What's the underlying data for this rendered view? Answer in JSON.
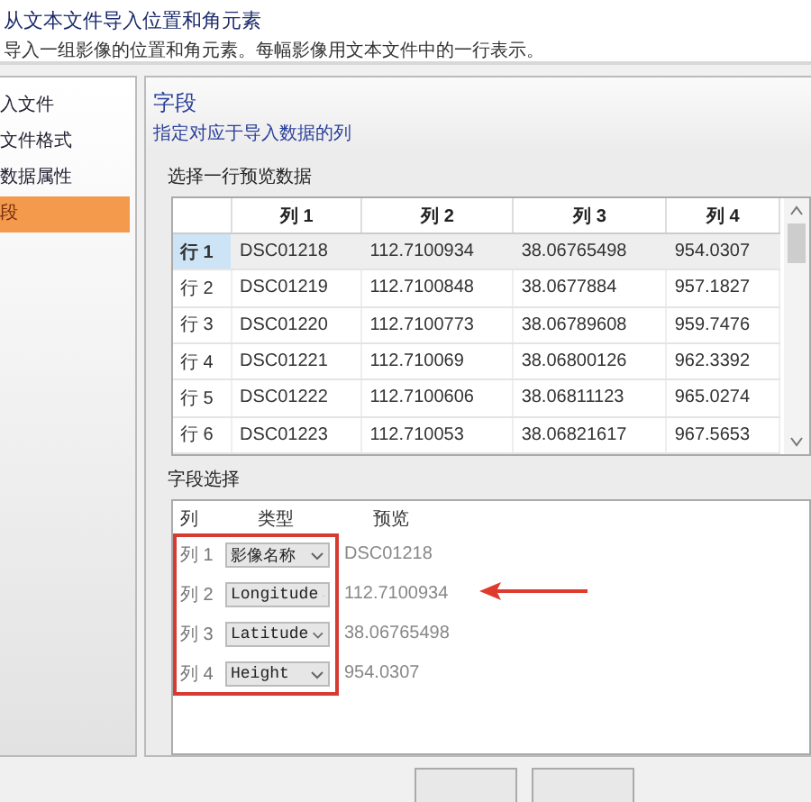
{
  "dialog": {
    "title": "从文本文件导入位置和角元素",
    "subtitle": "导入一组影像的位置和角元素。每幅影像用文本文件中的一行表示。"
  },
  "sidebar": {
    "items": [
      {
        "label": "入文件",
        "selected": false
      },
      {
        "label": "文件格式",
        "selected": false
      },
      {
        "label": "数据属性",
        "selected": false
      },
      {
        "label": "段",
        "selected": true
      }
    ]
  },
  "page": {
    "heading": "字段",
    "description": "指定对应于导入数据的列"
  },
  "preview": {
    "label": "选择一行预览数据",
    "columns": [
      "列 1",
      "列 2",
      "列 3",
      "列 4"
    ],
    "rows": [
      {
        "header": "行 1",
        "selected": true,
        "cells": [
          "DSC01218",
          "112.7100934",
          "38.06765498",
          "954.0307"
        ]
      },
      {
        "header": "行 2",
        "selected": false,
        "cells": [
          "DSC01219",
          "112.7100848",
          "38.0677884",
          "957.1827"
        ]
      },
      {
        "header": "行 3",
        "selected": false,
        "cells": [
          "DSC01220",
          "112.7100773",
          "38.06789608",
          "959.7476"
        ]
      },
      {
        "header": "行 4",
        "selected": false,
        "cells": [
          "DSC01221",
          "112.710069",
          "38.06800126",
          "962.3392"
        ]
      },
      {
        "header": "行 5",
        "selected": false,
        "cells": [
          "DSC01222",
          "112.7100606",
          "38.06811123",
          "965.0274"
        ]
      },
      {
        "header": "行 6",
        "selected": false,
        "cells": [
          "DSC01223",
          "112.710053",
          "38.06821617",
          "967.5653"
        ]
      }
    ]
  },
  "field_selection": {
    "label": "字段选择",
    "columns": [
      "列",
      "类型",
      "预览"
    ],
    "rows": [
      {
        "label": "列 1",
        "type": "影像名称",
        "preview": "DSC01218"
      },
      {
        "label": "列 2",
        "type": "Longitude",
        "preview": "112.7100934"
      },
      {
        "label": "列 3",
        "type": "Latitude",
        "preview": "38.06765498"
      },
      {
        "label": "列 4",
        "type": "Height",
        "preview": "954.0307"
      }
    ]
  }
}
